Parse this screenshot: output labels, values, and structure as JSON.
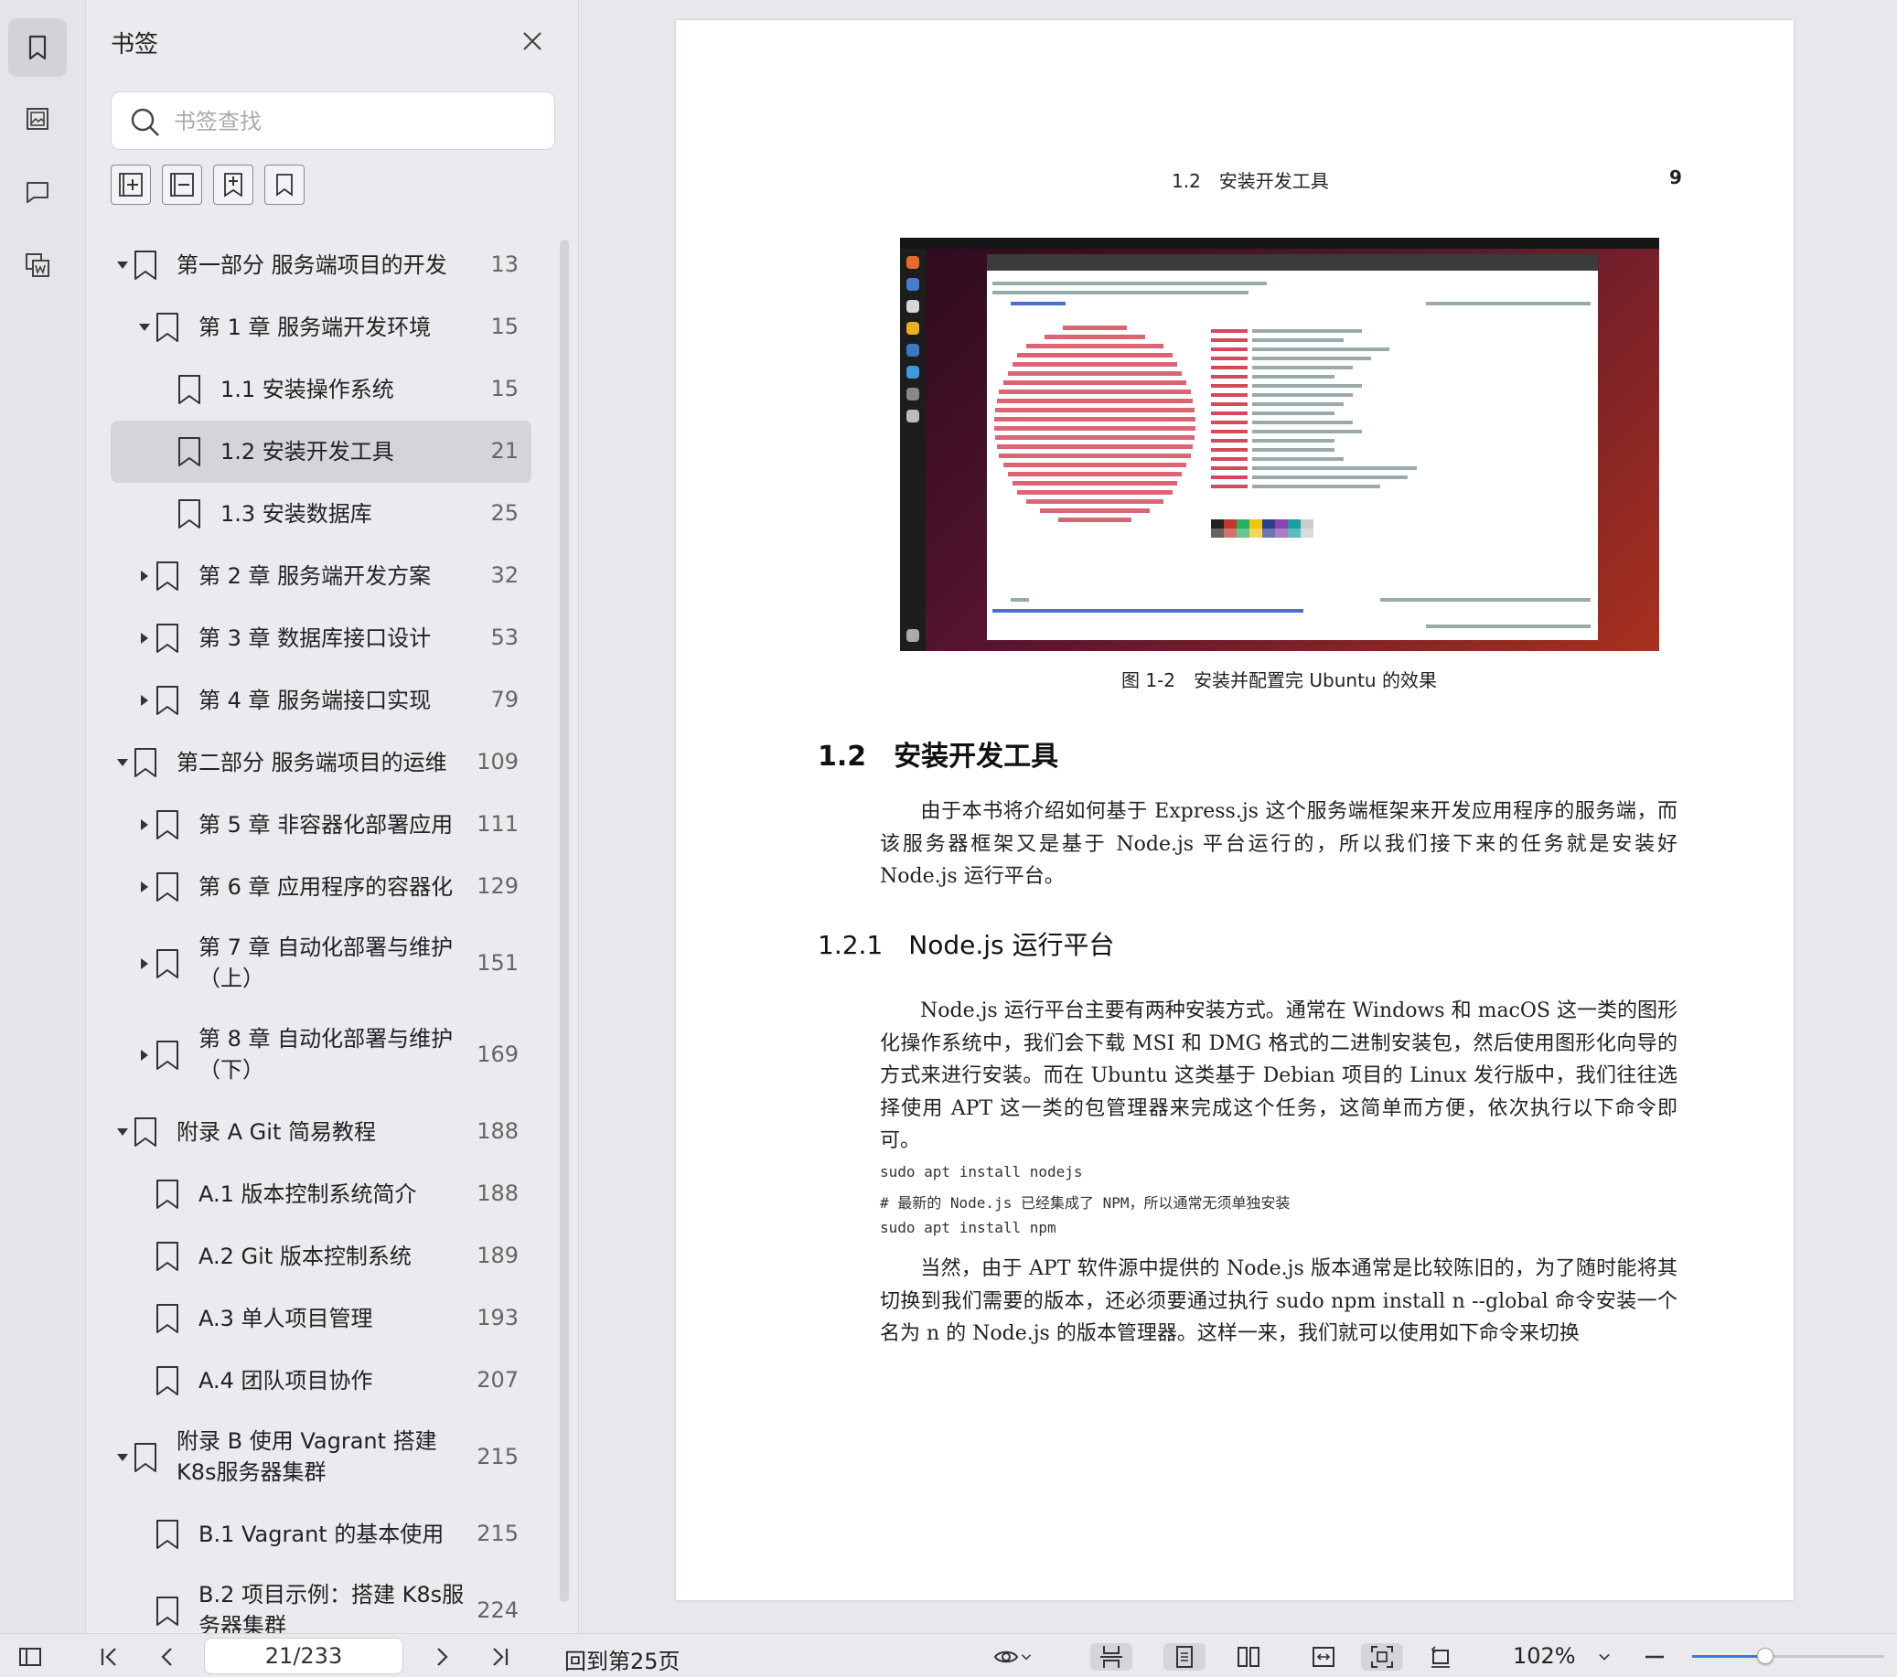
{
  "panel": {
    "title": "书签",
    "search_placeholder": "书签查找"
  },
  "bookmarks": [
    {
      "label": "第一部分 服务端项目的开发",
      "page": "13",
      "level": 0,
      "caret": "down"
    },
    {
      "label": "第 1 章 服务端开发环境",
      "page": "15",
      "level": 1,
      "caret": "down"
    },
    {
      "label": "1.1 安装操作系统",
      "page": "15",
      "level": 2,
      "caret": ""
    },
    {
      "label": "1.2 安装开发工具",
      "page": "21",
      "level": 2,
      "caret": "",
      "selected": true
    },
    {
      "label": "1.3 安装数据库",
      "page": "25",
      "level": 2,
      "caret": ""
    },
    {
      "label": "第 2 章 服务端开发方案",
      "page": "32",
      "level": 1,
      "caret": "right"
    },
    {
      "label": "第 3 章 数据库接口设计",
      "page": "53",
      "level": 1,
      "caret": "right"
    },
    {
      "label": "第 4 章 服务端接口实现",
      "page": "79",
      "level": 1,
      "caret": "right"
    },
    {
      "label": "第二部分 服务端项目的运维",
      "page": "109",
      "level": 0,
      "caret": "down"
    },
    {
      "label": "第 5 章 非容器化部署应用",
      "page": "111",
      "level": 1,
      "caret": "right"
    },
    {
      "label": "第 6 章 应用程序的容器化",
      "page": "129",
      "level": 1,
      "caret": "right"
    },
    {
      "label": "第 7 章 自动化部署与维护（上）",
      "page": "151",
      "level": 1,
      "caret": "right",
      "lines": 2
    },
    {
      "label": "第 8 章 自动化部署与维护（下）",
      "page": "169",
      "level": 1,
      "caret": "right",
      "lines": 2
    },
    {
      "label": "附录 A Git 简易教程",
      "page": "188",
      "level": 0,
      "caret": "down"
    },
    {
      "label": "A.1 版本控制系统简介",
      "page": "188",
      "level": 1,
      "caret": ""
    },
    {
      "label": "A.2 Git 版本控制系统",
      "page": "189",
      "level": 1,
      "caret": ""
    },
    {
      "label": "A.3 单人项目管理",
      "page": "193",
      "level": 1,
      "caret": ""
    },
    {
      "label": "A.4 团队项目协作",
      "page": "207",
      "level": 1,
      "caret": ""
    },
    {
      "label": "附录 B 使用 Vagrant 搭建 K8s服务器集群",
      "page": "215",
      "level": 0,
      "caret": "down",
      "lines": 2
    },
    {
      "label": "B.1 Vagrant 的基本使用",
      "page": "215",
      "level": 1,
      "caret": ""
    },
    {
      "label": "B.2 项目示例：搭建 K8s服务器集群",
      "page": "224",
      "level": 1,
      "caret": "",
      "lines": 2
    }
  ],
  "document": {
    "running_head": "1.2　安装开发工具",
    "page_number": "9",
    "figure_caption": "图 1-2　安装并配置完 Ubuntu 的效果",
    "section_title": "1.2　安装开发工具",
    "para1": "由于本书将介绍如何基于 Express.js 这个服务端框架来开发应用程序的服务端，而该服务器框架又是基于 Node.js 平台运行的，所以我们接下来的任务就是安装好 Node.js 运行平台。",
    "subsection_title": "1.2.1　Node.js 运行平台",
    "para2": "Node.js 运行平台主要有两种安装方式。通常在 Windows 和 macOS 这一类的图形化操作系统中，我们会下载 MSI 和 DMG 格式的二进制安装包，然后使用图形化向导的方式来进行安装。而在 Ubuntu 这类基于 Debian 项目的 Linux 发行版中，我们往往选择使用 APT 这一类的包管理器来完成这个任务，这简单而方便，依次执行以下命令即可。",
    "code1": "sudo apt install nodejs",
    "code2": "# 最新的 Node.js 已经集成了 NPM，所以通常无须单独安装",
    "code3": "sudo apt install npm",
    "para3": "当然，由于 APT 软件源中提供的 Node.js 版本通常是比较陈旧的，为了随时能将其切换到我们需要的版本，还必须要通过执行 sudo npm install n --global 命令安装一个名为 n 的 Node.js 的版本管理器。这样一来，我们就可以使用如下命令来切换"
  },
  "bottombar": {
    "page_value": "21/233",
    "goto_label": "回到第25页",
    "zoom_label": "102%",
    "zoom_slider_fraction": 0.38
  },
  "colors": {
    "accent": "#3b7de0",
    "selection": "#d6d3da"
  }
}
